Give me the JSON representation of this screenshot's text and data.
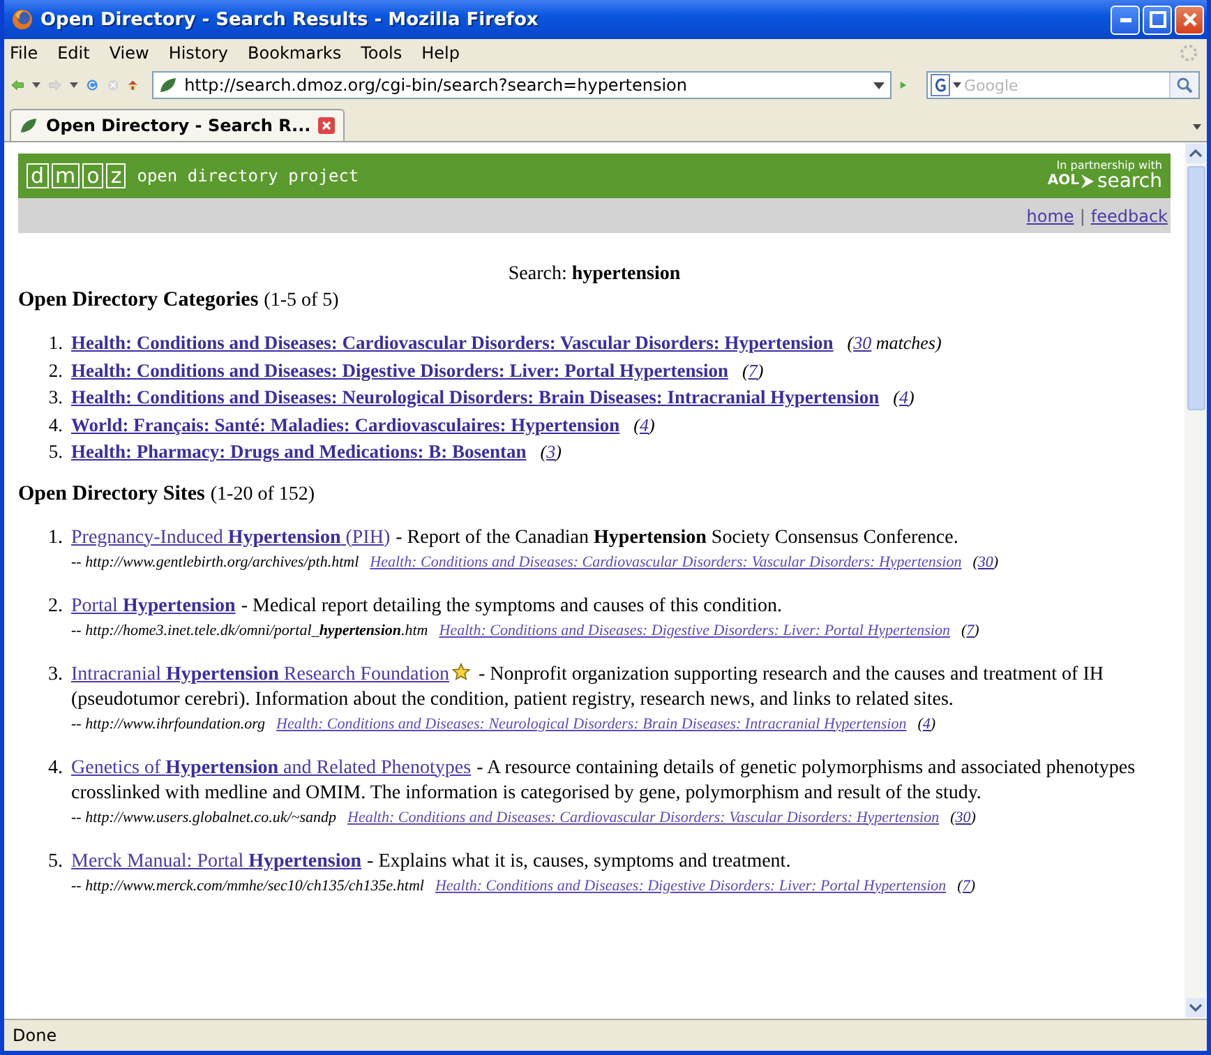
{
  "window": {
    "title": "Open Directory - Search Results - Mozilla Firefox"
  },
  "menu": [
    {
      "label": "File"
    },
    {
      "label": "Edit"
    },
    {
      "label": "View"
    },
    {
      "label": "History"
    },
    {
      "label": "Bookmarks"
    },
    {
      "label": "Tools"
    },
    {
      "label": "Help"
    }
  ],
  "toolbar": {
    "url": "http://search.dmoz.org/cgi-bin/search?search=hypertension",
    "search_placeholder": "Google"
  },
  "tabs": [
    {
      "label": "Open Directory - Search R...",
      "selected": true
    }
  ],
  "banner": {
    "logo": [
      "d",
      "m",
      "o",
      "z"
    ],
    "tagline": "open directory project",
    "partner_line": "In partnership with",
    "partner_brand": "AOL",
    "partner_product": "search"
  },
  "nav_links": [
    {
      "label": "home"
    },
    {
      "label": "feedback"
    }
  ],
  "nav_separator": "|",
  "search_label": "Search: **hypertension**",
  "categories": {
    "heading": "Open Directory Categories",
    "range": "(1-5 of 5)",
    "items": [
      {
        "number": "1.",
        "label": "Health: Conditions and Diseases: Cardiovascular Disorders: Vascular Disorders: Hypertension",
        "count_prefix": "(",
        "count": "30",
        "count_suffix": " matches)"
      },
      {
        "number": "2.",
        "label": "Health: Conditions and Diseases: Digestive Disorders: Liver: Portal Hypertension",
        "count_prefix": "(",
        "count": "7",
        "count_suffix": ")"
      },
      {
        "number": "3.",
        "label": "Health: Conditions and Diseases: Neurological Disorders: Brain Diseases: Intracranial Hypertension",
        "count_prefix": "(",
        "count": "4",
        "count_suffix": ")"
      },
      {
        "number": "4.",
        "label": "World: Français: Santé: Maladies: Cardiovasculaires: Hypertension",
        "count_prefix": "(",
        "count": "4",
        "count_suffix": ")"
      },
      {
        "number": "5.",
        "label": "Health: Pharmacy: Drugs and Medications: B: Bosentan",
        "count_prefix": "(",
        "count": "3",
        "count_suffix": ")"
      }
    ]
  },
  "sites": {
    "heading": "Open Directory Sites",
    "range": "(1-20 of 152)",
    "items": [
      {
        "number": "1.",
        "title": "Pregnancy-Induced **Hypertension** (PIH)",
        "editors_pick": false,
        "description": "- Report of the Canadian **Hypertension** Society Consensus Conference.",
        "url": "-- http://www.gentlebirth.org/archives/pth.html",
        "category": "Health: Conditions and Diseases: Cardiovascular Disorders: Vascular Disorders: Hypertension",
        "count_prefix": "(",
        "count": "30",
        "count_suffix": ")"
      },
      {
        "number": "2.",
        "title": "Portal **Hypertension**",
        "editors_pick": false,
        "description": "- Medical report detailing the symptoms and causes of this condition.",
        "url": "-- http://home3.inet.tele.dk/omni/portal_**hypertension**.htm",
        "category": "Health: Conditions and Diseases: Digestive Disorders: Liver: Portal Hypertension",
        "count_prefix": "(",
        "count": "7",
        "count_suffix": ")"
      },
      {
        "number": "3.",
        "title": "Intracranial **Hypertension** Research Foundation",
        "editors_pick": true,
        "description": "- Nonprofit organization supporting research and the causes and treatment of IH (pseudotumor cerebri). Information about the condition, patient registry, research news, and links to related sites.",
        "url": "-- http://www.ihrfoundation.org",
        "category": "Health: Conditions and Diseases: Neurological Disorders: Brain Diseases: Intracranial Hypertension",
        "count_prefix": "(",
        "count": "4",
        "count_suffix": ")"
      },
      {
        "number": "4.",
        "title": "Genetics of **Hypertension** and Related Phenotypes",
        "editors_pick": false,
        "description": "- A resource containing details of genetic polymorphisms and associated phenotypes crosslinked with medline and OMIM. The information is categorised by gene, polymorphism and result of the study.",
        "url": "-- http://www.users.globalnet.co.uk/~sandp",
        "category": "Health: Conditions and Diseases: Cardiovascular Disorders: Vascular Disorders: Hypertension",
        "count_prefix": "(",
        "count": "30",
        "count_suffix": ")"
      },
      {
        "number": "5.",
        "title": "Merck Manual: Portal **Hypertension**",
        "editors_pick": false,
        "description": "- Explains what it is, causes, symptoms and treatment.",
        "url": "-- http://www.merck.com/mmhe/sec10/ch135/ch135e.html",
        "category": "Health: Conditions and Diseases: Digestive Disorders: Liver: Portal Hypertension",
        "count_prefix": "(",
        "count": "7",
        "count_suffix": ")"
      }
    ]
  },
  "status_bar": {
    "text": "Done"
  }
}
